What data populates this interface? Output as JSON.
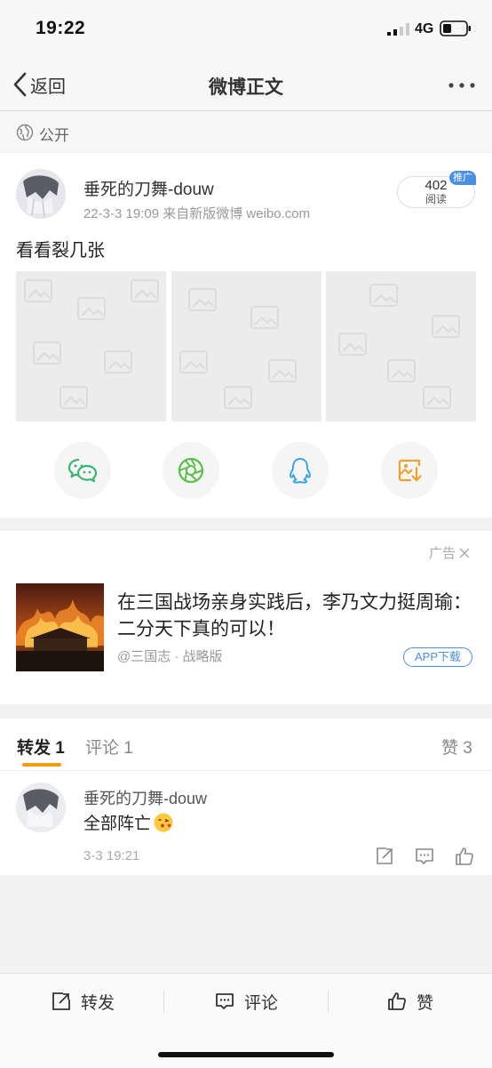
{
  "status_bar": {
    "time": "19:22",
    "network": "4G"
  },
  "nav": {
    "back_label": "返回",
    "title": "微博正文"
  },
  "visibility": {
    "label": "公开"
  },
  "post": {
    "username": "垂死的刀舞-douw",
    "meta": "22-3-3 19:09  来自新版微博 weibo.com",
    "read_count": "402",
    "read_label": "阅读",
    "promo_tag": "推广",
    "text": "看看裂几张",
    "images": [
      "placeholder",
      "placeholder",
      "placeholder"
    ],
    "share_targets": [
      {
        "icon": "wechat-icon",
        "color": "#3cb371"
      },
      {
        "icon": "moments-icon",
        "color": "#5bbd4b"
      },
      {
        "icon": "qq-icon",
        "color": "#3aa4e0"
      },
      {
        "icon": "save-image-icon",
        "color": "#f0a030"
      }
    ]
  },
  "ad": {
    "label": "广告",
    "title": "在三国战场亲身实践后，李乃文力挺周瑜：二分天下真的可以！",
    "source": "@三国志 · 战略版",
    "download_label": "APP下载"
  },
  "tabs": {
    "repost_label": "转发",
    "repost_count": "1",
    "comment_label": "评论",
    "comment_count": "1",
    "like_label": "赞",
    "like_count": "3"
  },
  "comment": {
    "username": "垂死的刀舞-douw",
    "text": "全部阵亡",
    "time": "3-3 19:21"
  },
  "bottom_bar": {
    "repost": "转发",
    "comment": "评论",
    "like": "赞"
  },
  "colors": {
    "accent": "#f39c12",
    "link_blue": "#4b8fe0"
  }
}
